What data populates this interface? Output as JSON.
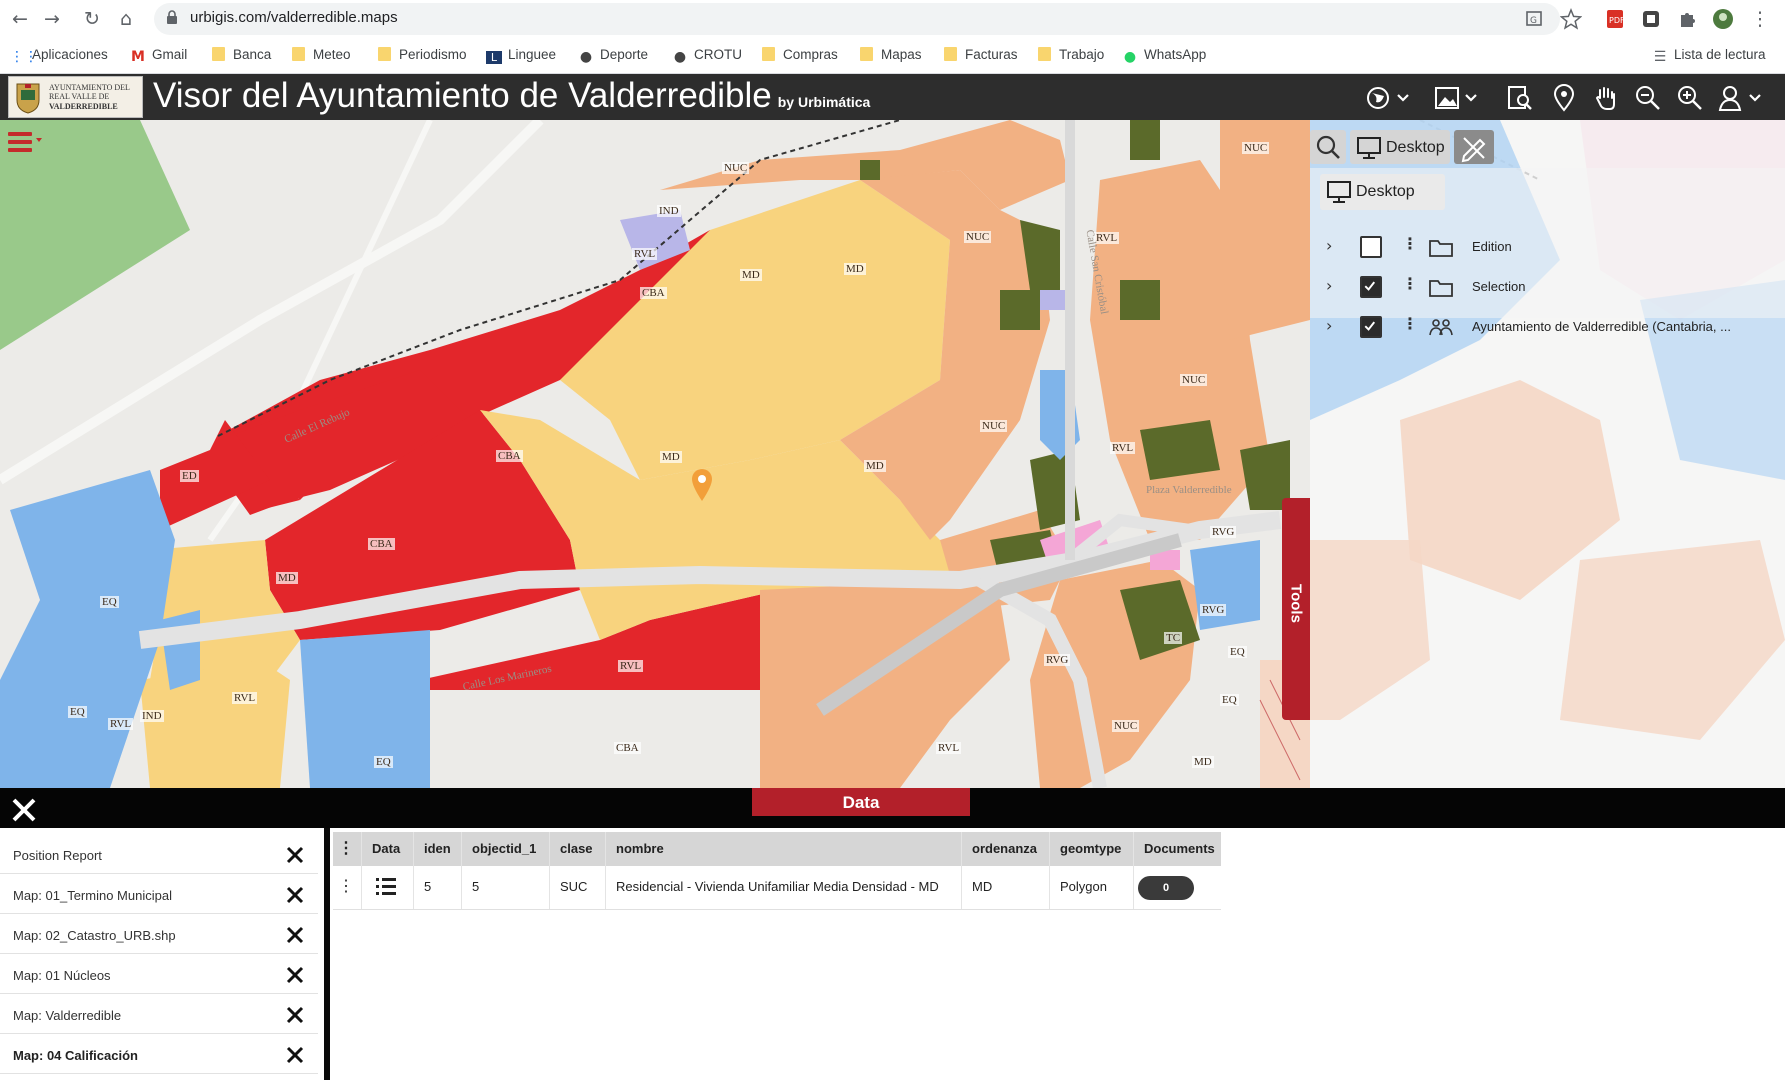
{
  "browser": {
    "url": "urbigis.com/valderredible.maps",
    "bookmarks": [
      {
        "label": "Aplicaciones",
        "icon": "apps-grid-icon"
      },
      {
        "label": "Gmail",
        "icon": "gmail-icon"
      },
      {
        "label": "Banca",
        "icon": "folder-icon"
      },
      {
        "label": "Meteo",
        "icon": "folder-icon"
      },
      {
        "label": "Periodismo",
        "icon": "folder-icon"
      },
      {
        "label": "Linguee",
        "icon": "linguee-icon"
      },
      {
        "label": "Deporte",
        "icon": "deporte-icon"
      },
      {
        "label": "CROTU",
        "icon": "crotu-icon"
      },
      {
        "label": "Compras",
        "icon": "folder-icon"
      },
      {
        "label": "Mapas",
        "icon": "folder-icon"
      },
      {
        "label": "Facturas",
        "icon": "folder-icon"
      },
      {
        "label": "Trabajo",
        "icon": "folder-icon"
      },
      {
        "label": "WhatsApp",
        "icon": "whatsapp-icon"
      }
    ],
    "reading_list": "Lista de lectura"
  },
  "header": {
    "logo_lines": [
      "AYUNTAMIENTO DEL",
      "REAL VALLE DE",
      "VALDERREDIBLE"
    ],
    "title": "Visor del Ayuntamiento de Valderredible",
    "by": "by Urbimática"
  },
  "map": {
    "labels": [
      "NUC",
      "IND",
      "RVL",
      "CBA",
      "MD",
      "MD",
      "NUC",
      "RVL",
      "NUC",
      "NUC",
      "RVL",
      "CBA",
      "MD",
      "MD",
      "CBA",
      "MD",
      "ED",
      "EQ",
      "EQ",
      "RVL",
      "IND",
      "RVL",
      "RVL",
      "CBA",
      "EQ",
      "NUC",
      "RVL",
      "RVG",
      "RVG",
      "TC",
      "EQ",
      "EQ",
      "NUC",
      "MD",
      "RVG"
    ],
    "streets": [
      "Calle El Rebujo",
      "Calle Los Marineros",
      "Calle San Cristóbal",
      "Plaza Valderredible"
    ]
  },
  "panel": {
    "tab_desktop": "Desktop",
    "section": "Desktop",
    "layers": [
      {
        "name": "Edition",
        "checked": false
      },
      {
        "name": "Selection",
        "checked": true
      },
      {
        "name": "Ayuntamiento de Valderredible (Cantabria, ...",
        "checked": true
      }
    ],
    "tools": "Tools"
  },
  "data_panel": {
    "tab": "Data",
    "list": [
      {
        "label": "Position Report",
        "active": false
      },
      {
        "label": "Map: 01_Termino Municipal",
        "active": false
      },
      {
        "label": "Map: 02_Catastro_URB.shp",
        "active": false
      },
      {
        "label": "Map: 01 Núcleos",
        "active": false
      },
      {
        "label": "Map: Valderredible",
        "active": false
      },
      {
        "label": "Map: 04 Calificación",
        "active": true
      }
    ],
    "columns": [
      "Data",
      "iden",
      "objectid_1",
      "clase",
      "nombre",
      "ordenanza",
      "geomtype",
      "Documents"
    ],
    "row": {
      "iden": "5",
      "objectid_1": "5",
      "clase": "SUC",
      "nombre": "Residencial - Vivienda Unifamiliar Media Densidad - MD",
      "ordenanza": "MD",
      "geomtype": "Polygon",
      "documents": "0"
    }
  },
  "colors": {
    "header_bg": "#2d2d2d",
    "accent_red": "#b3202a",
    "zone_cba": "#e3262b",
    "zone_md": "#f8d37e",
    "zone_nuc": "#f2b183",
    "zone_eq": "#7fb4ea",
    "zone_green": "#5b6a2a"
  }
}
